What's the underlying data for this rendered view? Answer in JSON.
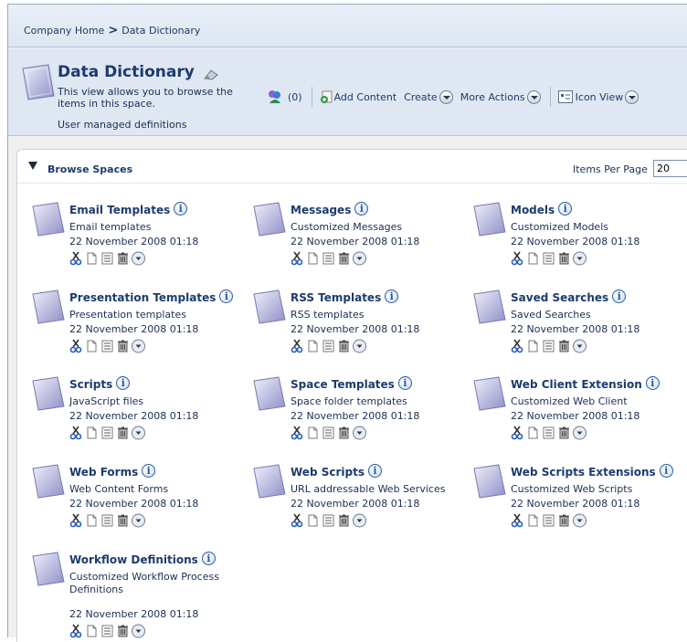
{
  "breadcrumb": {
    "home": "Company Home",
    "separator": ">",
    "current": "Data Dictionary"
  },
  "header": {
    "title": "Data Dictionary",
    "description": "This view allows you to browse the items in this space.",
    "subdescription": "User managed definitions"
  },
  "toolbar": {
    "count": "(0)",
    "add_content": "Add Content",
    "create": "Create",
    "more_actions": "More Actions",
    "view": "Icon View"
  },
  "browse": {
    "title": "Browse Spaces",
    "items_per_page_label": "Items Per Page",
    "items_per_page_value": "20"
  },
  "spaces": [
    {
      "name": "Email Templates",
      "description": "Email templates",
      "date": "22 November 2008 01:18"
    },
    {
      "name": "Messages",
      "description": "Customized Messages",
      "date": "22 November 2008 01:18"
    },
    {
      "name": "Models",
      "description": "Customized Models",
      "date": "22 November 2008 01:18"
    },
    {
      "name": "Presentation Templates",
      "description": "Presentation templates",
      "date": "22 November 2008 01:18"
    },
    {
      "name": "RSS Templates",
      "description": "RSS templates",
      "date": "22 November 2008 01:18"
    },
    {
      "name": "Saved Searches",
      "description": "Saved Searches",
      "date": "22 November 2008 01:18"
    },
    {
      "name": "Scripts",
      "description": "JavaScript files",
      "date": "22 November 2008 01:18"
    },
    {
      "name": "Space Templates",
      "description": "Space folder templates",
      "date": "22 November 2008 01:18"
    },
    {
      "name": "Web Client Extension",
      "description": "Customized Web Client",
      "date": "22 November 2008 01:18"
    },
    {
      "name": "Web Forms",
      "description": "Web Content Forms",
      "date": "22 November 2008 01:18"
    },
    {
      "name": "Web Scripts",
      "description": "URL addressable Web Services",
      "date": "22 November 2008 01:18"
    },
    {
      "name": "Web Scripts Extensions",
      "description": "Customized Web Scripts",
      "date": "22 November 2008 01:18"
    },
    {
      "name": "Workflow Definitions",
      "description": "Customized Workflow Process Definitions",
      "date": "22 November 2008 01:18"
    }
  ],
  "icons": {
    "space": "space-folder-icon",
    "info": "info-icon",
    "cut": "cut-icon",
    "copy": "copy-icon",
    "details": "details-icon",
    "delete": "delete-icon",
    "more": "more-actions-icon"
  },
  "colors": {
    "link": "#1d3b6e",
    "header_bg": "#dfe7f2",
    "panel_bg": "#ffffff"
  }
}
